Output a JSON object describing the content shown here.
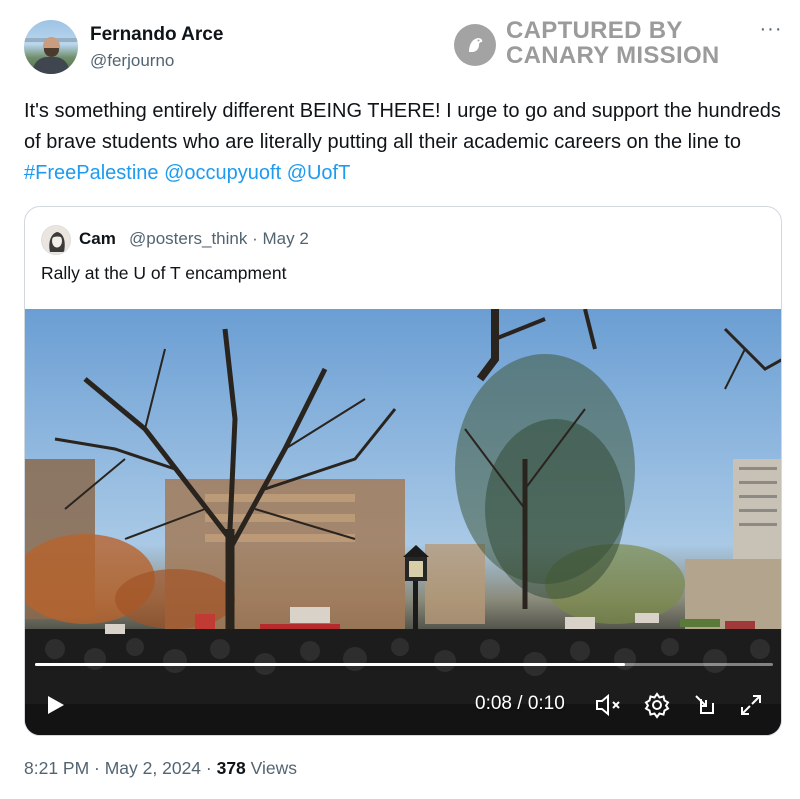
{
  "author": {
    "name": "Fernando Arce",
    "handle": "@ferjourno"
  },
  "watermark": {
    "line1": "CAPTURED BY",
    "line2": "CANARY MISSION"
  },
  "more_menu": "···",
  "tweet": {
    "text_part1": "It's something entirely different BEING THERE! I urge to go and support the hundreds of brave students who are literally putting all their academic careers on the line to ",
    "hashtag": "#FreePalestine",
    "mention1": "@occupyuoft",
    "mention2": "@UofT"
  },
  "quoted_tweet": {
    "name": "Cam",
    "handle_date": "@posters_think · May 2",
    "text": "Rally at the U of T encampment"
  },
  "video": {
    "time": "0:08 / 0:10",
    "progress": 0.8
  },
  "meta": {
    "timestamp": "8:21 PM · May 2, 2024 · ",
    "views_count": "378",
    "views_label": " Views"
  },
  "icons": [
    "more-icon",
    "canary-logo-icon",
    "play-icon",
    "volume-muted-icon",
    "settings-icon",
    "exit-icon",
    "fullscreen-icon"
  ]
}
